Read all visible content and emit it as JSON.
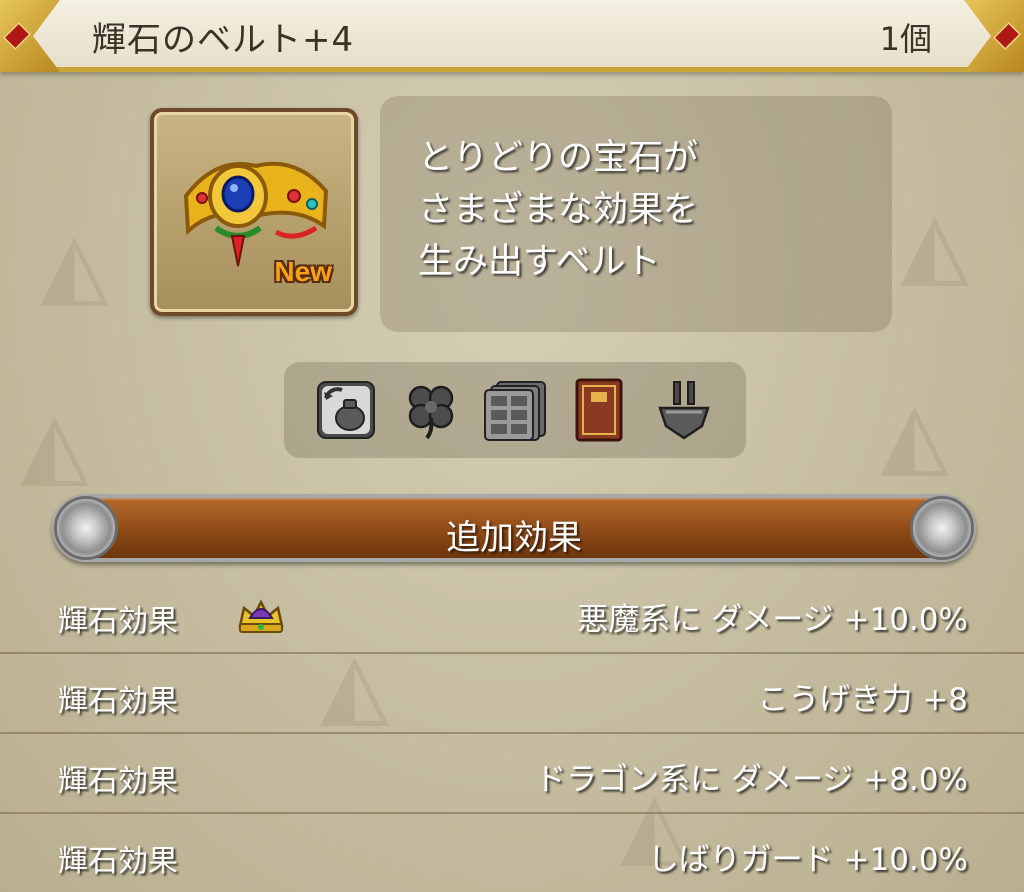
{
  "header": {
    "title": "輝石のベルト+4",
    "count": "1個"
  },
  "item": {
    "new_badge": "New",
    "description_lines": [
      "とりどりの宝石が",
      "さまざまな効果を",
      "生み出すベルト"
    ]
  },
  "equip_icons": [
    {
      "name": "bag-swap-icon"
    },
    {
      "name": "clover-icon"
    },
    {
      "name": "storage-chest-icon"
    },
    {
      "name": "book-icon"
    },
    {
      "name": "armor-stand-icon"
    }
  ],
  "section": {
    "title": "追加効果"
  },
  "effects": [
    {
      "label": "輝石効果",
      "value": "悪魔系に ダメージ +10.0%",
      "has_crown": true
    },
    {
      "label": "輝石効果",
      "value": "こうげき力 +8",
      "has_crown": false
    },
    {
      "label": "輝石効果",
      "value": "ドラゴン系に ダメージ +8.0%",
      "has_crown": false
    },
    {
      "label": "輝石効果",
      "value": "しばりガード +10.0%",
      "has_crown": false
    }
  ],
  "colors": {
    "header_gold": "#c9a437",
    "section_brown": "#8e4a17",
    "new_orange": "#f6a21a"
  }
}
